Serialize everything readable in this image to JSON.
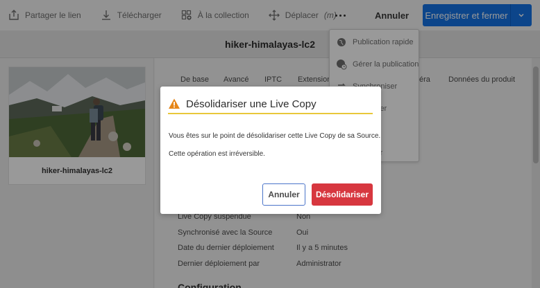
{
  "toolbar": {
    "share_label": "Partager le lien",
    "download_label": "Télécharger",
    "collection_label": "À la collection",
    "move_label": "Déplacer",
    "move_shortcut": "(m)",
    "cancel_label": "Annuler",
    "save_label": "Enregistrer et fermer"
  },
  "title": "hiker-himalayas-lc2",
  "asset_card": {
    "name": "hiker-himalayas-lc2"
  },
  "tabs": [
    "De base",
    "Avancé",
    "IPTC",
    "Extension",
    "éra",
    "Données du produit"
  ],
  "menu": {
    "items": [
      "Publication rapide",
      "Gérer la publication",
      "Synchroniser",
      "ier",
      "e",
      "liser"
    ]
  },
  "properties": [
    {
      "key": "Live Copy suspendue",
      "value": "Non"
    },
    {
      "key": "Synchronisé avec la Source",
      "value": "Oui"
    },
    {
      "key": "Date du dernier déploiement",
      "value": "Il y a 5 minutes"
    },
    {
      "key": "Dernier déploiement par",
      "value": "Administrator"
    }
  ],
  "section_heading": "Configuration",
  "dialog": {
    "title": "Désolidariser une Live Copy",
    "message1": "Vous êtes sur le point de désolidariser cette Live Copy de sa Source.",
    "message2": "Cette opération est irréversible.",
    "cancel_label": "Annuler",
    "confirm_label": "Désolidariser"
  },
  "colors": {
    "primary": "#1473e6",
    "danger": "#d7373f",
    "warning": "#e8c73a"
  }
}
